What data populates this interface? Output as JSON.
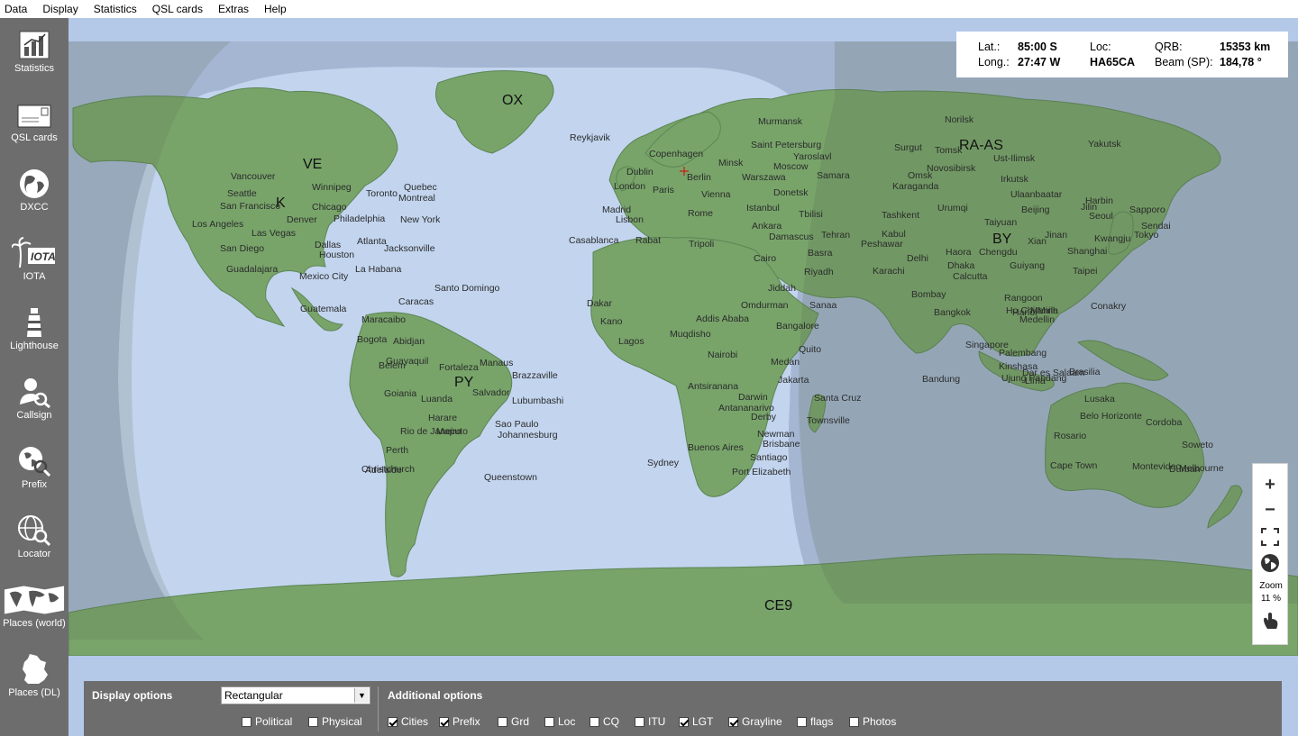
{
  "menu": [
    "Data",
    "Display",
    "Statistics",
    "QSL cards",
    "Extras",
    "Help"
  ],
  "sidebar": [
    {
      "label": "Statistics",
      "icon": "statistics-chart-icon"
    },
    {
      "label": "QSL cards",
      "icon": "qsl-card-icon"
    },
    {
      "label": "DXCC",
      "icon": "globe-icon"
    },
    {
      "label": "IOTA",
      "icon": "iota-palm-icon"
    },
    {
      "label": "Lighthouse",
      "icon": "lighthouse-icon"
    },
    {
      "label": "Callsign",
      "icon": "callsign-search-icon"
    },
    {
      "label": "Prefix",
      "icon": "prefix-search-icon"
    },
    {
      "label": "Locator",
      "icon": "locator-globe-icon"
    },
    {
      "label": "Places (world)",
      "icon": "world-map-icon"
    },
    {
      "label": "Places (DL)",
      "icon": "germany-map-icon"
    }
  ],
  "info": {
    "lat_label": "Lat.:",
    "lat_value": "85:00 S",
    "long_label": "Long.:",
    "long_value": "27:47 W",
    "loc_label": "Loc:",
    "loc_value": "HA65CA",
    "qrb_label": "QRB:",
    "qrb_value": "15353 km",
    "beam_label": "Beam (SP):",
    "beam_value": "184,78 °"
  },
  "zoom": {
    "label": "Zoom",
    "value": "11 %"
  },
  "prefixes": [
    "OX",
    "VE",
    "K",
    "RA-AS",
    "BY",
    "PY",
    "CE9"
  ],
  "cities": [
    "Reykjavik",
    "Copenhagen",
    "Murmansk",
    "Norilsk",
    "Yakutsk",
    "Saint Petersburg",
    "Surgut",
    "Tomsk",
    "Yaroslavl",
    "Ust-Ilimsk",
    "Dublin",
    "Minsk",
    "Moscow",
    "Omsk",
    "Novosibirsk",
    "Irkutsk",
    "London",
    "Berlin",
    "Warszawa",
    "Samara",
    "Paris",
    "Vienna",
    "Donetsk",
    "Karaganda",
    "Ulaanbaatar",
    "Harbin",
    "Vancouver",
    "Winnipeg",
    "Quebec",
    "Seattle",
    "Toronto",
    "Montreal",
    "San Francisco",
    "Chicago",
    "Denver",
    "Philadelphia",
    "New York",
    "Los Angeles",
    "Las Vegas",
    "Madrid",
    "Lisbon",
    "Rome",
    "Istanbul",
    "Tbilisi",
    "Tashkent",
    "Urumqi",
    "Beijing",
    "Seoul",
    "Sapporo",
    "Jilin",
    "Sendai",
    "San Diego",
    "Dallas",
    "Atlanta",
    "Jacksonville",
    "Ankara",
    "Damascus",
    "Tehran",
    "Kabul",
    "Peshawar",
    "Taiyuan",
    "Jinan",
    "Kwangju",
    "Tokyo",
    "Guadalajara",
    "Houston",
    "Casablanca",
    "Rabat",
    "Tripoli",
    "Cairo",
    "Basra",
    "Delhi",
    "Haora",
    "Chengdu",
    "Xian",
    "Shanghai",
    "Mexico City",
    "La Habana",
    "Riyadh",
    "Karachi",
    "Dhaka",
    "Guiyang",
    "Taipei",
    "Santo Domingo",
    "Jiddah",
    "Calcutta",
    "Caracas",
    "Guatemala",
    "Maracaibo",
    "Dakar",
    "Omdurman",
    "Sanaa",
    "Bombay",
    "Rangoon",
    "Hanoi",
    "Manila",
    "Conakry",
    "Kano",
    "Addis Ababa",
    "Bangalore",
    "Bangkok",
    "Ho Chi Minh",
    "Medellin",
    "Bogota",
    "Abidjan",
    "Lagos",
    "Muqdisho",
    "Quito",
    "Guayaquil",
    "Belem",
    "Manaus",
    "Fortaleza",
    "Brazzaville",
    "Nairobi",
    "Medan",
    "Singapore",
    "Palembang",
    "Kinshasa",
    "Dar es Salaam",
    "Jakarta",
    "Bandung",
    "Ujung Pandang",
    "Lima",
    "Brasilia",
    "Goiania",
    "Salvador",
    "Luanda",
    "Lubumbashi",
    "Antsiranana",
    "Darwin",
    "Santa Cruz",
    "Lusaka",
    "Harare",
    "Antananarivo",
    "Derby",
    "Townsville",
    "Belo Horizonte",
    "Cordoba",
    "Sao Paulo",
    "Rio de Janeiro",
    "Maputo",
    "Johannesburg",
    "Newman",
    "Brisbane",
    "Rosario",
    "Soweto",
    "Perth",
    "Buenos Aires",
    "Cape Town",
    "Durban",
    "Adelaide",
    "Sydney",
    "Santiago",
    "Port Elizabeth",
    "Montevideo",
    "Melbourne",
    "Christchurch",
    "Queenstown"
  ],
  "options": {
    "display_heading": "Display options",
    "projection": "Rectangular",
    "political": "Political",
    "physical": "Physical",
    "additional_heading": "Additional options",
    "checks": [
      {
        "label": "Cities",
        "checked": true
      },
      {
        "label": "Prefix",
        "checked": true
      },
      {
        "label": "Grd",
        "checked": false
      },
      {
        "label": "Loc",
        "checked": false
      },
      {
        "label": "CQ",
        "checked": false
      },
      {
        "label": "ITU",
        "checked": false
      },
      {
        "label": "LGT",
        "checked": true
      },
      {
        "label": "Grayline",
        "checked": true
      },
      {
        "label": "flags",
        "checked": false
      },
      {
        "label": "Photos",
        "checked": false
      }
    ]
  }
}
